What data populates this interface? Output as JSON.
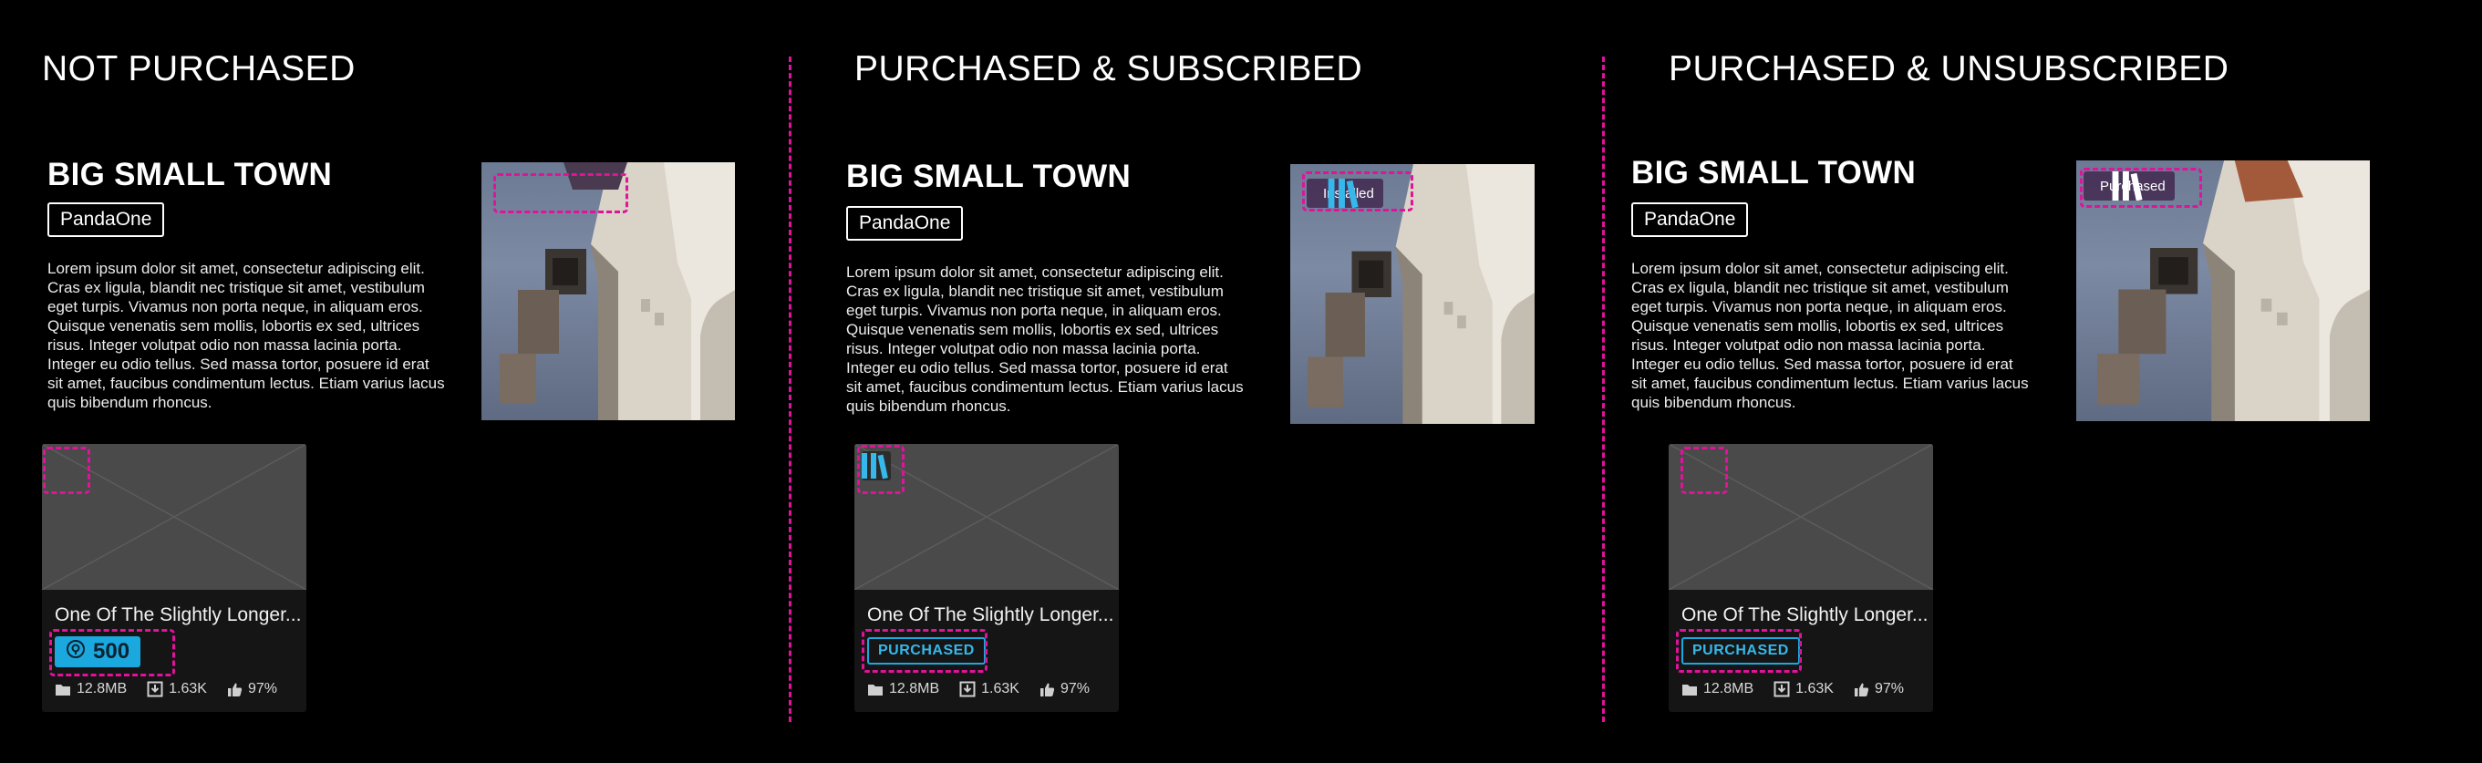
{
  "colors": {
    "highlight": "#e0139a",
    "accent": "#1ba8de",
    "background": "#000000"
  },
  "columns": [
    {
      "heading": "NOT PURCHASED",
      "title": "BIG SMALL TOWN",
      "publisher": "PandaOne",
      "description": "Lorem ipsum dolor sit amet, consectetur adipiscing elit. Cras ex ligula, blandit nec tristique sit amet, vestibulum eget turpis. Vivamus non porta neque, in aliquam eros. Quisque venenatis sem mollis, lobortis ex sed, ultrices risus. Integer volutpat odio non massa lacinia porta. Integer eu odio tellus. Sed massa tortor, posuere id erat sit amet, faucibus condimentum lectus. Etiam varius lacus quis bibendum rhoncus.",
      "cover_badge": "",
      "card": {
        "title": "One Of The Slightly Longer...",
        "price": "500",
        "size": "12.8MB",
        "downloads": "1.63K",
        "rating": "97%"
      }
    },
    {
      "heading": "PURCHASED & SUBSCRIBED",
      "title": "BIG SMALL TOWN",
      "publisher": "PandaOne",
      "description": "Lorem ipsum dolor sit amet, consectetur adipiscing elit. Cras ex ligula, blandit nec tristique sit amet, vestibulum eget turpis. Vivamus non porta neque, in aliquam eros. Quisque venenatis sem mollis, lobortis ex sed, ultrices risus. Integer volutpat odio non massa lacinia porta. Integer eu odio tellus. Sed massa tortor, posuere id erat sit amet, faucibus condimentum lectus. Etiam varius lacus quis bibendum rhoncus.",
      "cover_badge": "Installed",
      "card": {
        "title": "One Of The Slightly Longer...",
        "status": "PURCHASED",
        "size": "12.8MB",
        "downloads": "1.63K",
        "rating": "97%"
      }
    },
    {
      "heading": "PURCHASED & UNSUBSCRIBED",
      "title": "BIG SMALL TOWN",
      "publisher": "PandaOne",
      "description": "Lorem ipsum dolor sit amet, consectetur adipiscing elit. Cras ex ligula, blandit nec tristique sit amet, vestibulum eget turpis. Vivamus non porta neque, in aliquam eros. Quisque venenatis sem mollis, lobortis ex sed, ultrices risus. Integer volutpat odio non massa lacinia porta. Integer eu odio tellus. Sed massa tortor, posuere id erat sit amet, faucibus condimentum lectus. Etiam varius lacus quis bibendum rhoncus.",
      "cover_badge": "Purchased",
      "card": {
        "title": "One Of The Slightly Longer...",
        "status": "PURCHASED",
        "size": "12.8MB",
        "downloads": "1.63K",
        "rating": "97%"
      }
    }
  ]
}
